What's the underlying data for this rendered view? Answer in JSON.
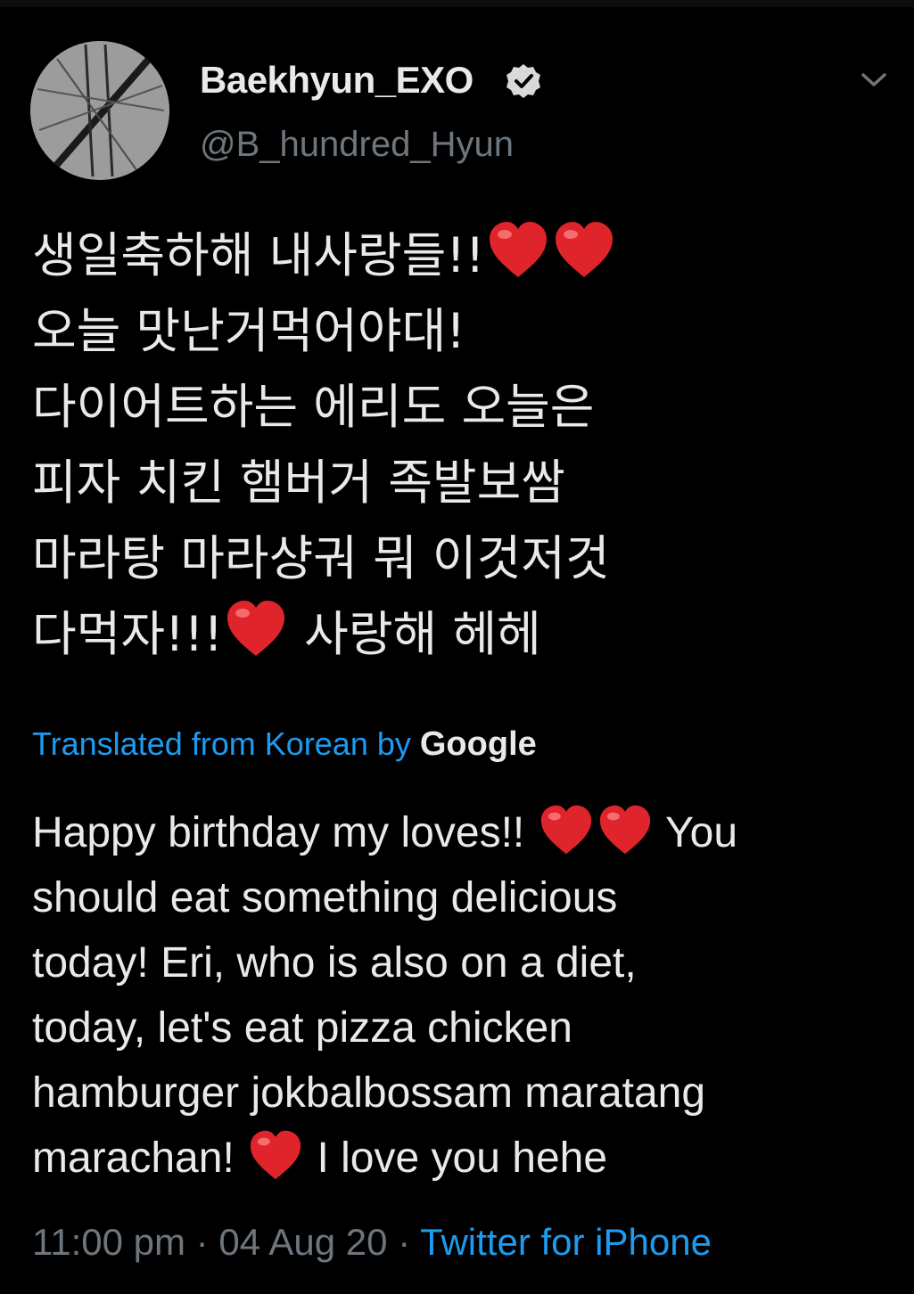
{
  "tweet": {
    "display_name": "Baekhyun_EXO",
    "handle": "@B_hundred_Hyun",
    "korean_lines": [
      "생일축하해 내사랑들!!",
      "오늘 맛난거먹어야대!",
      "다이어트하는 에리도 오늘은",
      "피자 치킨 햄버거 족발보쌈",
      "마라탕 마라샹궈 뭐 이것저것",
      "다먹자!!!",
      "사랑해 헤헤"
    ],
    "translation": {
      "label": "Translated from Korean by",
      "provider": "Google"
    },
    "english_lines": [
      "Happy birthday my loves!!",
      "You",
      "should eat something delicious",
      "today! Eri, who is also on a diet,",
      "today, let's eat pizza chicken",
      "hamburger jokbalbossam maratang",
      "marachan!",
      "I love you hehe"
    ],
    "time": "11:00 pm",
    "date": "04 Aug 20",
    "separator": "·",
    "source": "Twitter for iPhone"
  },
  "icons": {
    "verified": "verified-badge-icon",
    "menu": "chevron-down-icon",
    "heart": "red-heart-emoji"
  },
  "colors": {
    "background": "#000000",
    "primary_text": "#e7e9ea",
    "secondary_text": "#6e767d",
    "link": "#1d9bf0",
    "heart": "#e0242b"
  }
}
